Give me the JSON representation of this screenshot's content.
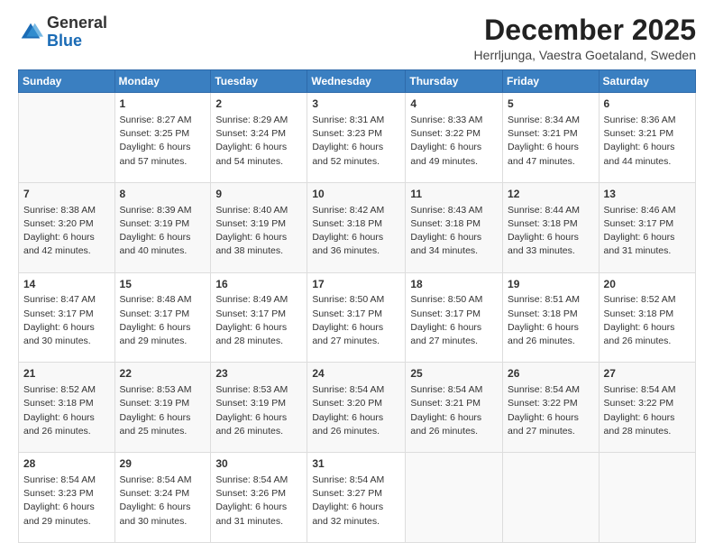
{
  "header": {
    "logo_general": "General",
    "logo_blue": "Blue",
    "month_title": "December 2025",
    "location": "Herrljunga, Vaestra Goetaland, Sweden"
  },
  "weekdays": [
    "Sunday",
    "Monday",
    "Tuesday",
    "Wednesday",
    "Thursday",
    "Friday",
    "Saturday"
  ],
  "weeks": [
    [
      {
        "day": "",
        "info": ""
      },
      {
        "day": "1",
        "info": "Sunrise: 8:27 AM\nSunset: 3:25 PM\nDaylight: 6 hours\nand 57 minutes."
      },
      {
        "day": "2",
        "info": "Sunrise: 8:29 AM\nSunset: 3:24 PM\nDaylight: 6 hours\nand 54 minutes."
      },
      {
        "day": "3",
        "info": "Sunrise: 8:31 AM\nSunset: 3:23 PM\nDaylight: 6 hours\nand 52 minutes."
      },
      {
        "day": "4",
        "info": "Sunrise: 8:33 AM\nSunset: 3:22 PM\nDaylight: 6 hours\nand 49 minutes."
      },
      {
        "day": "5",
        "info": "Sunrise: 8:34 AM\nSunset: 3:21 PM\nDaylight: 6 hours\nand 47 minutes."
      },
      {
        "day": "6",
        "info": "Sunrise: 8:36 AM\nSunset: 3:21 PM\nDaylight: 6 hours\nand 44 minutes."
      }
    ],
    [
      {
        "day": "7",
        "info": "Sunrise: 8:38 AM\nSunset: 3:20 PM\nDaylight: 6 hours\nand 42 minutes."
      },
      {
        "day": "8",
        "info": "Sunrise: 8:39 AM\nSunset: 3:19 PM\nDaylight: 6 hours\nand 40 minutes."
      },
      {
        "day": "9",
        "info": "Sunrise: 8:40 AM\nSunset: 3:19 PM\nDaylight: 6 hours\nand 38 minutes."
      },
      {
        "day": "10",
        "info": "Sunrise: 8:42 AM\nSunset: 3:18 PM\nDaylight: 6 hours\nand 36 minutes."
      },
      {
        "day": "11",
        "info": "Sunrise: 8:43 AM\nSunset: 3:18 PM\nDaylight: 6 hours\nand 34 minutes."
      },
      {
        "day": "12",
        "info": "Sunrise: 8:44 AM\nSunset: 3:18 PM\nDaylight: 6 hours\nand 33 minutes."
      },
      {
        "day": "13",
        "info": "Sunrise: 8:46 AM\nSunset: 3:17 PM\nDaylight: 6 hours\nand 31 minutes."
      }
    ],
    [
      {
        "day": "14",
        "info": "Sunrise: 8:47 AM\nSunset: 3:17 PM\nDaylight: 6 hours\nand 30 minutes."
      },
      {
        "day": "15",
        "info": "Sunrise: 8:48 AM\nSunset: 3:17 PM\nDaylight: 6 hours\nand 29 minutes."
      },
      {
        "day": "16",
        "info": "Sunrise: 8:49 AM\nSunset: 3:17 PM\nDaylight: 6 hours\nand 28 minutes."
      },
      {
        "day": "17",
        "info": "Sunrise: 8:50 AM\nSunset: 3:17 PM\nDaylight: 6 hours\nand 27 minutes."
      },
      {
        "day": "18",
        "info": "Sunrise: 8:50 AM\nSunset: 3:17 PM\nDaylight: 6 hours\nand 27 minutes."
      },
      {
        "day": "19",
        "info": "Sunrise: 8:51 AM\nSunset: 3:18 PM\nDaylight: 6 hours\nand 26 minutes."
      },
      {
        "day": "20",
        "info": "Sunrise: 8:52 AM\nSunset: 3:18 PM\nDaylight: 6 hours\nand 26 minutes."
      }
    ],
    [
      {
        "day": "21",
        "info": "Sunrise: 8:52 AM\nSunset: 3:18 PM\nDaylight: 6 hours\nand 26 minutes."
      },
      {
        "day": "22",
        "info": "Sunrise: 8:53 AM\nSunset: 3:19 PM\nDaylight: 6 hours\nand 25 minutes."
      },
      {
        "day": "23",
        "info": "Sunrise: 8:53 AM\nSunset: 3:19 PM\nDaylight: 6 hours\nand 26 minutes."
      },
      {
        "day": "24",
        "info": "Sunrise: 8:54 AM\nSunset: 3:20 PM\nDaylight: 6 hours\nand 26 minutes."
      },
      {
        "day": "25",
        "info": "Sunrise: 8:54 AM\nSunset: 3:21 PM\nDaylight: 6 hours\nand 26 minutes."
      },
      {
        "day": "26",
        "info": "Sunrise: 8:54 AM\nSunset: 3:22 PM\nDaylight: 6 hours\nand 27 minutes."
      },
      {
        "day": "27",
        "info": "Sunrise: 8:54 AM\nSunset: 3:22 PM\nDaylight: 6 hours\nand 28 minutes."
      }
    ],
    [
      {
        "day": "28",
        "info": "Sunrise: 8:54 AM\nSunset: 3:23 PM\nDaylight: 6 hours\nand 29 minutes."
      },
      {
        "day": "29",
        "info": "Sunrise: 8:54 AM\nSunset: 3:24 PM\nDaylight: 6 hours\nand 30 minutes."
      },
      {
        "day": "30",
        "info": "Sunrise: 8:54 AM\nSunset: 3:26 PM\nDaylight: 6 hours\nand 31 minutes."
      },
      {
        "day": "31",
        "info": "Sunrise: 8:54 AM\nSunset: 3:27 PM\nDaylight: 6 hours\nand 32 minutes."
      },
      {
        "day": "",
        "info": ""
      },
      {
        "day": "",
        "info": ""
      },
      {
        "day": "",
        "info": ""
      }
    ]
  ]
}
